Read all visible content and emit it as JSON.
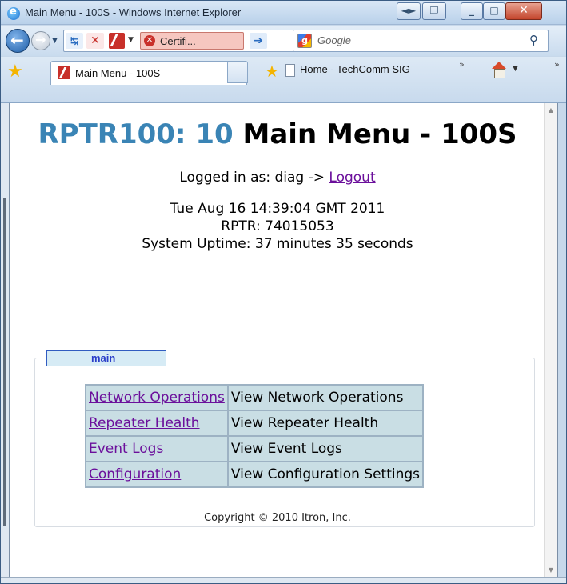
{
  "window": {
    "title": "Main Menu - 100S - Windows Internet Explorer"
  },
  "toolbar": {
    "certificate_label": "Certifi...",
    "search_placeholder": "Google"
  },
  "tabs": [
    {
      "label": "Main Menu - 100S"
    }
  ],
  "favorites": [
    {
      "label": "Home - TechComm SIG"
    }
  ],
  "page": {
    "title_prefix": "RPTR100: 10",
    "title_rest": " Main Menu - 100S",
    "logged_in_prefix": "Logged in as: diag -> ",
    "logout_label": "Logout",
    "datetime": "Tue Aug 16 14:39:04 GMT 2011",
    "rptr": "RPTR: 74015053",
    "uptime": "System Uptime: 37 minutes 35 seconds",
    "panel_tab": "main",
    "menu": [
      {
        "link": "Network Operations",
        "desc": "View Network Operations"
      },
      {
        "link": "Repeater Health",
        "desc": "View Repeater Health"
      },
      {
        "link": "Event Logs",
        "desc": "View Event Logs"
      },
      {
        "link": "Configuration",
        "desc": "View Configuration Settings"
      }
    ],
    "copyright": "Copyright © 2010 Itron, Inc."
  }
}
